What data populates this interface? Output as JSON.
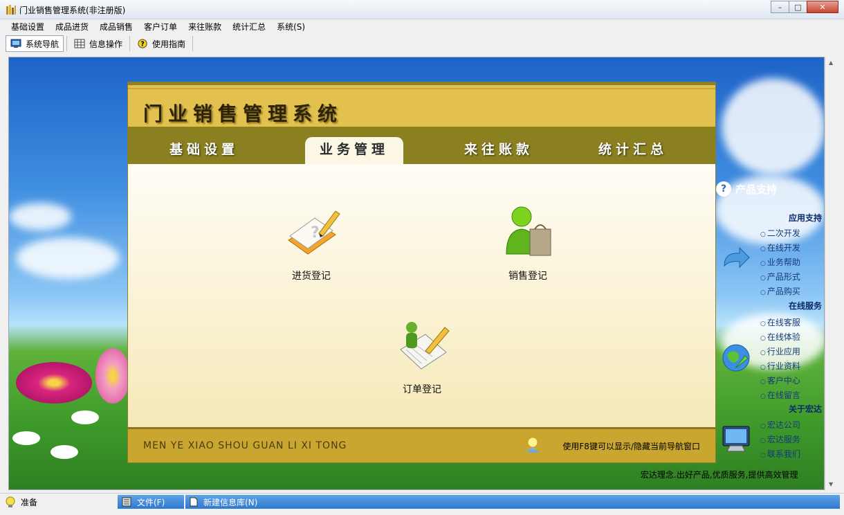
{
  "window": {
    "title": "门业销售管理系统(非注册版)",
    "minimize_label": "–",
    "maximize_label": "□",
    "close_label": "✕"
  },
  "menu": [
    "基础设置",
    "成品进货",
    "成品销售",
    "客户订单",
    "来往账款",
    "统计汇总",
    "系统(S)"
  ],
  "toolbar": {
    "nav": "系统导航",
    "info": "信息操作",
    "guide": "使用指南"
  },
  "panel": {
    "title": "门业销售管理系统",
    "tabs": [
      "基础设置",
      "业务管理",
      "来往账款",
      "统计汇总"
    ],
    "active_tab": "业务管理",
    "functions": {
      "purchase": "进货登记",
      "sales": "销售登记",
      "order": "订单登记"
    },
    "footer_pinyin": "MEN YE XIAO SHOU GUAN LI XI TONG",
    "footer_hint": "使用F8键可以显示/隐藏当前导航窗口"
  },
  "support": {
    "title": "产品支持",
    "sections": [
      {
        "title": "应用支持",
        "items": [
          "二次开发",
          "在线开发",
          "业务帮助",
          "产品形式",
          "产品购买"
        ]
      },
      {
        "title": "在线服务",
        "items": [
          "在线客服",
          "在线体验",
          "行业应用",
          "行业资料",
          "客户中心",
          "在线留言"
        ]
      },
      {
        "title": "关于宏达",
        "items": [
          "宏达公司",
          "宏达服务",
          "联系我们"
        ]
      }
    ],
    "slogan": "宏达理念.出好产品,优质服务,提供高效管理"
  },
  "status": {
    "ready": "准备",
    "file": "文件(F)",
    "new_db": "新建信息库(N)"
  },
  "colors": {
    "panel_gold": "#e2c14e",
    "tab_olive": "#8a801f",
    "footer_gold": "#c9a62f",
    "status_blue": "#2f78cf"
  }
}
